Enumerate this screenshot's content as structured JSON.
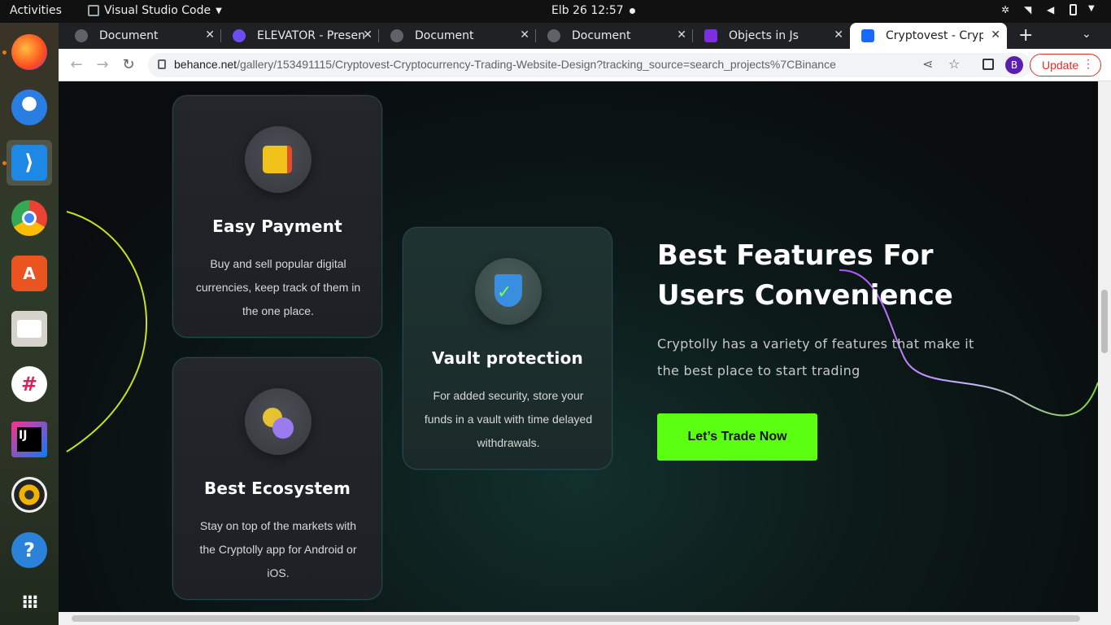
{
  "system": {
    "activities": "Activities",
    "app_name": "Visual Studio Code",
    "clock": "Elb 26  12:57"
  },
  "dock": [
    "firefox-icon",
    "thunderbird-icon",
    "vscode-icon",
    "chrome-icon",
    "app-center-icon",
    "files-icon",
    "slack-icon",
    "intellij-icon",
    "rhythmbox-icon",
    "help-icon",
    "show-apps-icon"
  ],
  "browser": {
    "tabs": [
      {
        "title": "Document",
        "color": "#5f6368"
      },
      {
        "title": "ELEVATOR - Presen",
        "color": "#6c4df4"
      },
      {
        "title": "Document",
        "color": "#5f6368"
      },
      {
        "title": "Document",
        "color": "#5f6368"
      },
      {
        "title": "Objects in Js",
        "color": "#7b2fe0"
      },
      {
        "title": "Cryptovest - Crypto",
        "color": "#1769ff"
      }
    ],
    "url_domain": "behance.net",
    "url_path": "/gallery/153491115/Cryptovest-Cryptocurrency-Trading-Website-Design?tracking_source=search_projects%7CBinance",
    "profile_initial": "B",
    "update_label": "Update"
  },
  "page": {
    "cards": [
      {
        "title": "Easy Payment",
        "text": "Buy and sell popular digital currencies, keep track of them in the one place.",
        "icon": "wallet-icon"
      },
      {
        "title": "Best Ecosystem",
        "text": "Stay on top of the markets with the Cryptolly app for Android or iOS.",
        "icon": "coins-icon"
      },
      {
        "title": "Vault protection",
        "text": "For added security, store your funds in a vault with time delayed withdrawals.",
        "icon": "shield-check-icon"
      }
    ],
    "headline": "Best Features For Users Convenience",
    "subtext": "Cryptolly has a variety of features that make it the best place to start trading",
    "cta_label": "Let’s Trade Now",
    "accent": "#5bff10"
  }
}
